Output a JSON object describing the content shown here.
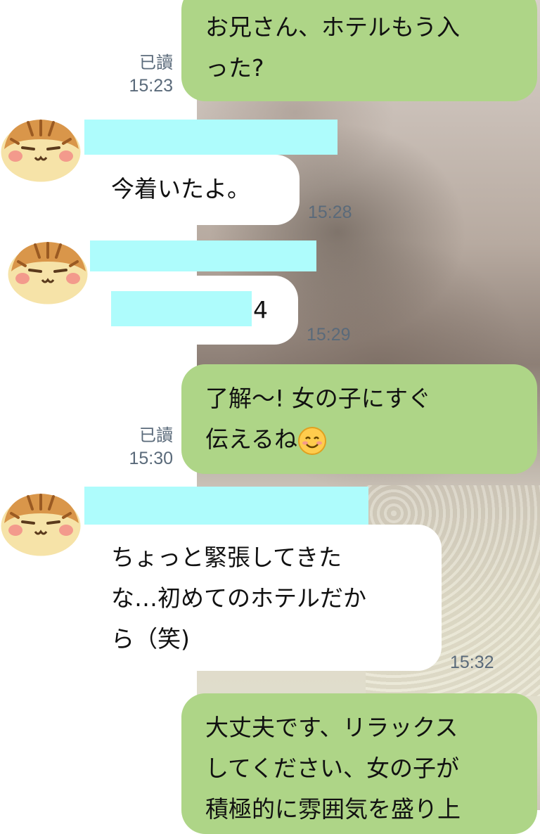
{
  "messages": [
    {
      "id": "m1",
      "direction": "out",
      "lines": [
        "お兄さん、ホテルもう入",
        "った?"
      ],
      "read": "已讀",
      "time": "15:23"
    },
    {
      "id": "m2",
      "direction": "in",
      "lines": [
        "今着いたよ。"
      ],
      "time": "15:28",
      "name_redacted": true
    },
    {
      "id": "m3",
      "direction": "in",
      "lines": [
        "4"
      ],
      "time": "15:29",
      "name_redacted": true,
      "text_partially_redacted": true
    },
    {
      "id": "m4",
      "direction": "out",
      "lines": [
        "了解〜!  女の子にすぐ",
        "伝えるね"
      ],
      "emoji": "smiling-face-emoji",
      "read": "已讀",
      "time": "15:30"
    },
    {
      "id": "m5",
      "direction": "in",
      "lines": [
        "ちょっと緊張してきた",
        "な…初めてのホテルだか",
        "ら（笑)"
      ],
      "time": "15:32",
      "name_redacted": true
    },
    {
      "id": "m6",
      "direction": "out",
      "lines": [
        "大丈夫です、リラックス",
        "してください、女の子が",
        "積極的に雰囲気を盛り上"
      ]
    }
  ],
  "colors": {
    "outgoing_bubble": "#aed587",
    "incoming_bubble": "#ffffff",
    "redaction": "#aefcfc",
    "meta_text": "#5a6a7a"
  },
  "icons": {
    "avatar": "tabby-cat-avatar-icon",
    "emoji": "smiling-face-emoji"
  }
}
